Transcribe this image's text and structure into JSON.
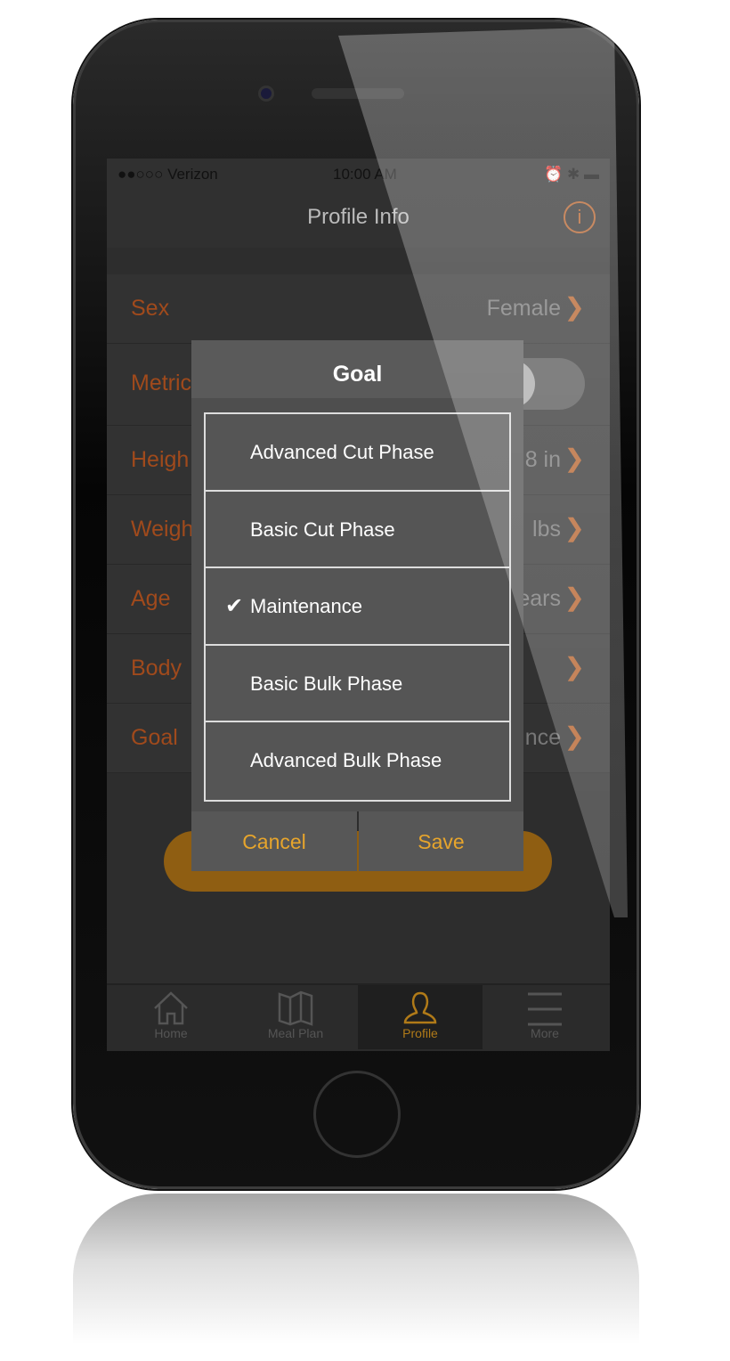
{
  "status": {
    "carrier": "●●○○○ Verizon",
    "time": "10:00 AM"
  },
  "nav": {
    "title": "Profile Info",
    "info_icon": "i"
  },
  "rows": [
    {
      "label": "Sex",
      "value": "Female"
    },
    {
      "label": "Metric",
      "value": ""
    },
    {
      "label": "Heigh",
      "value": "8 in"
    },
    {
      "label": "Weigh",
      "value": "lbs"
    },
    {
      "label": "Age",
      "value": "ears"
    },
    {
      "label": "Body",
      "value": ""
    },
    {
      "label": "Goal",
      "value": "nce"
    }
  ],
  "dialog": {
    "title": "Goal",
    "options": [
      "Advanced Cut Phase",
      "Basic Cut Phase",
      "Maintenance",
      "Basic Bulk Phase",
      "Advanced Bulk Phase"
    ],
    "selected": "Maintenance",
    "cancel": "Cancel",
    "save": "Save"
  },
  "tabs": [
    {
      "label": "Home",
      "icon": "home-icon"
    },
    {
      "label": "Meal Plan",
      "icon": "map-icon"
    },
    {
      "label": "Profile",
      "icon": "user-icon",
      "active": true
    },
    {
      "label": "More",
      "icon": "menu-icon"
    }
  ],
  "colors": {
    "accent": "#e7a52c",
    "label": "#a04a1c",
    "button": "#8f5e12"
  }
}
